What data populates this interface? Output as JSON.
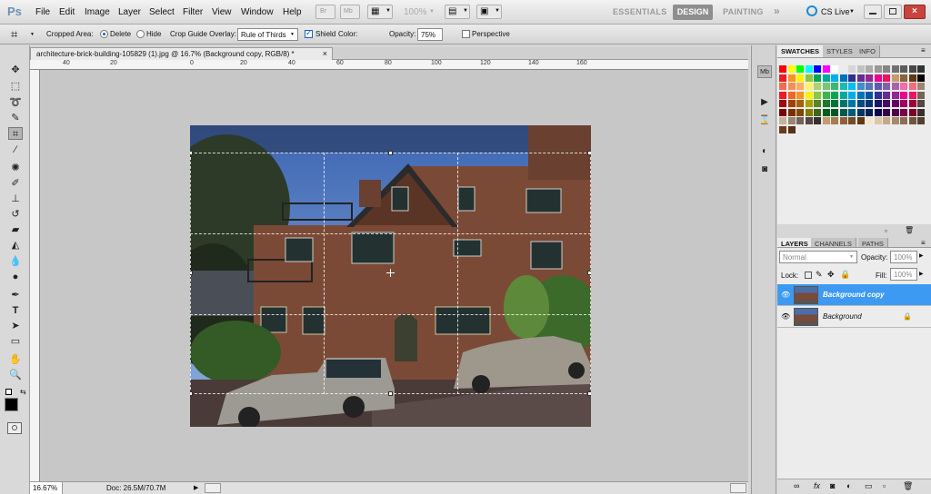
{
  "app": {
    "logo": "Ps"
  },
  "menu": [
    "File",
    "Edit",
    "Image",
    "Layer",
    "Select",
    "Filter",
    "View",
    "Window",
    "Help"
  ],
  "appbar": {
    "zoom": "100%",
    "workspaces": [
      "ESSENTIALS",
      "DESIGN",
      "PAINTING"
    ],
    "more": "»",
    "cslive": "CS Live"
  },
  "options": {
    "cropped_area_label": "Cropped Area:",
    "delete_label": "Delete",
    "hide_label": "Hide",
    "overlay_label": "Crop Guide Overlay:",
    "overlay_value": "Rule of Thirds",
    "shield_label": "Shield",
    "color_label": "Color:",
    "opacity_label": "Opacity:",
    "opacity_value": "75%",
    "perspective_label": "Perspective",
    "shield_color": "#000000"
  },
  "document": {
    "tab_title": "architecture-brick-building-105829 (1).jpg @ 16.7% (Background copy, RGB/8) *"
  },
  "ruler_top": [
    "40",
    "20",
    "0",
    "20",
    "40",
    "60",
    "80",
    "100",
    "120",
    "140",
    "160"
  ],
  "status": {
    "zoom": "16.67%",
    "doc": "Doc: 26.5M/70.7M"
  },
  "swatches": {
    "tabs": [
      "SWATCHES",
      "STYLES",
      "INFO"
    ]
  },
  "layers": {
    "tabs": [
      "LAYERS",
      "CHANNELS",
      "PATHS"
    ],
    "blend_mode": "Normal",
    "opacity_label": "Opacity:",
    "opacity_value": "100%",
    "lock_label": "Lock:",
    "fill_label": "Fill:",
    "fill_value": "100%",
    "items": [
      {
        "name": "Background copy",
        "selected": true
      },
      {
        "name": "Background",
        "selected": false
      }
    ]
  },
  "colors": {
    "selection": "#3d9af2",
    "accent": "#1b5fbf"
  }
}
